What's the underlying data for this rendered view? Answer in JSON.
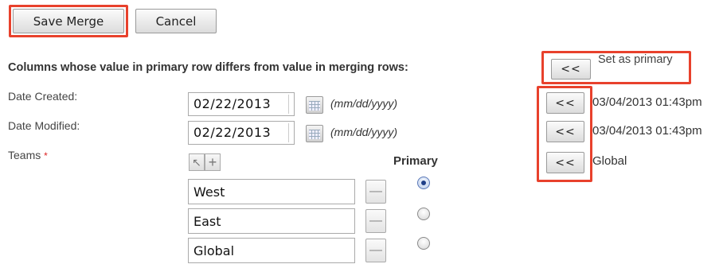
{
  "toolbar": {
    "save_label": "Save Merge",
    "cancel_label": "Cancel"
  },
  "section_heading": "Columns whose value in primary row differs from value in merging rows:",
  "set_primary": {
    "button_label": "<<",
    "label": "Set as primary"
  },
  "fields": [
    {
      "label": "Date Created:",
      "value": "02/22/2013",
      "hint": "(mm/dd/yyyy)",
      "copy_label": "<<",
      "merge_value": "03/04/2013 01:43pm"
    },
    {
      "label": "Date Modified:",
      "value": "02/22/2013",
      "hint": "(mm/dd/yyyy)",
      "copy_label": "<<",
      "merge_value": "03/04/2013 01:43pm"
    }
  ],
  "teams": {
    "label": "Teams",
    "required_mark": "*",
    "select_icon": "arrow-pointer-icon",
    "add_icon": "plus-icon",
    "primary_header": "Primary",
    "copy_label": "<<",
    "merge_value": "Global",
    "rows": [
      {
        "name": "West",
        "primary": true,
        "remove_icon": "minus-icon"
      },
      {
        "name": "East",
        "primary": false,
        "remove_icon": "minus-icon"
      },
      {
        "name": "Global",
        "primary": false,
        "remove_icon": "minus-icon"
      }
    ]
  },
  "colors": {
    "highlight": "#e8412c",
    "radio_selected": "#1f3f88"
  }
}
